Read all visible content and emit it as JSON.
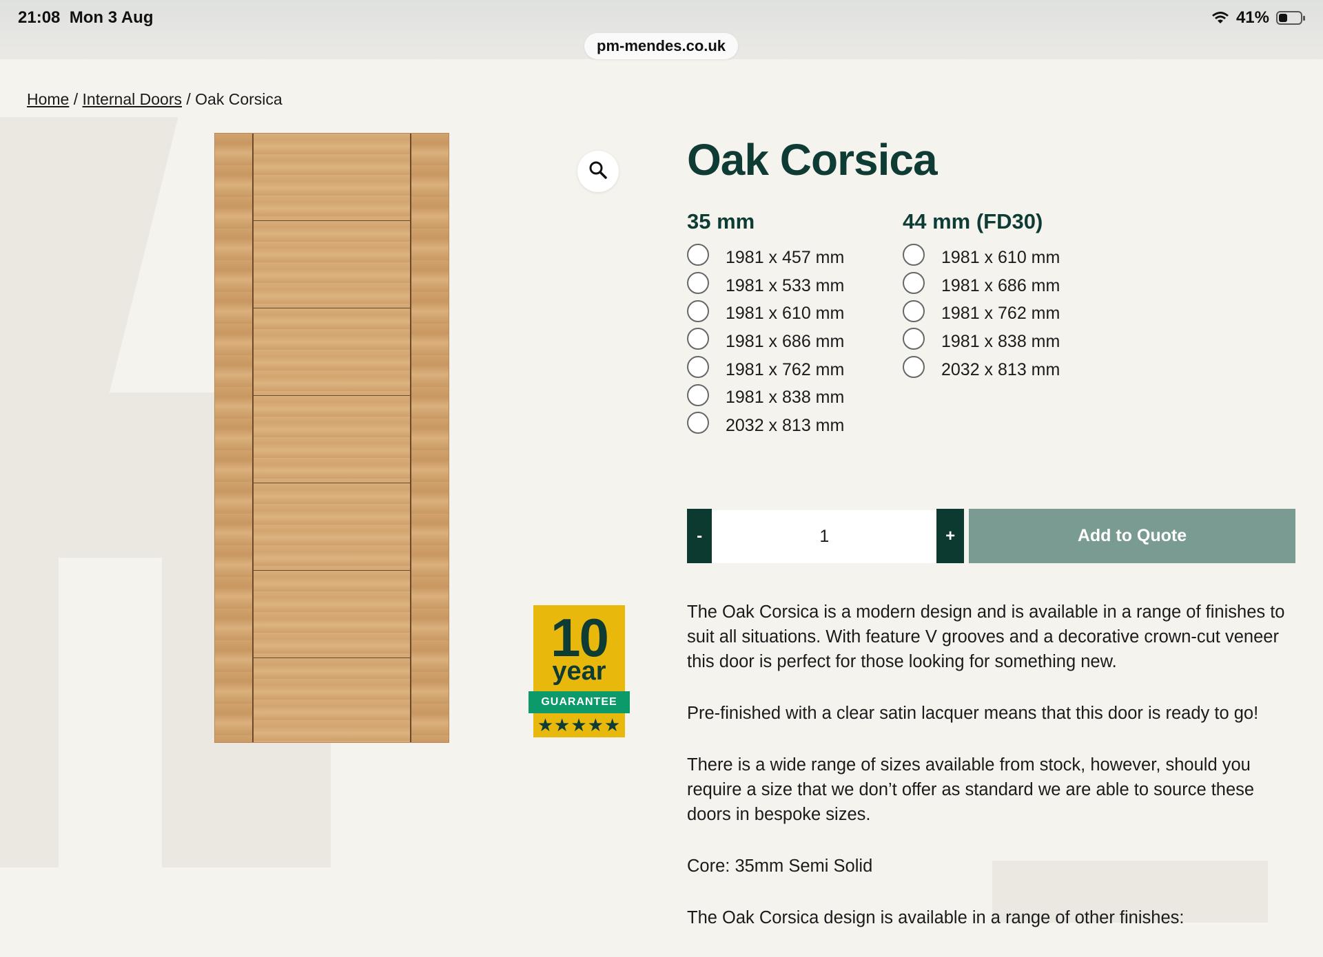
{
  "status_bar": {
    "time": "21:08",
    "date": "Mon 3 Aug",
    "battery": "41%",
    "battery_level": 0.41
  },
  "browser": {
    "url": "pm-mendes.co.uk"
  },
  "breadcrumb": {
    "home": "Home",
    "separator": "/",
    "category": "Internal Doors",
    "current": "Oak Corsica"
  },
  "product": {
    "title": "Oak Corsica",
    "image_icon": "door-image",
    "zoom_icon": "search-icon"
  },
  "guarantee_badge": {
    "number": "10",
    "unit": "year",
    "label": "GUARANTEE",
    "stars": "★★★★★"
  },
  "sizes": {
    "col1": {
      "heading": "35 mm",
      "options": [
        "1981 x 457 mm",
        "1981 x 533 mm",
        "1981 x 610 mm",
        "1981 x 686 mm",
        "1981 x 762 mm",
        "1981 x 838 mm",
        "2032 x 813 mm"
      ]
    },
    "col2": {
      "heading": "44 mm (FD30)",
      "options": [
        "1981 x 610 mm",
        "1981 x 686 mm",
        "1981 x 762 mm",
        "1981 x 838 mm",
        "2032 x 813 mm"
      ]
    }
  },
  "quantity": {
    "minus": "-",
    "value": "1",
    "plus": "+"
  },
  "add_to_quote": "Add to Quote",
  "description": {
    "p1": "The Oak Corsica is a modern design and is available in a range of finishes to suit all situations. With feature V grooves and a decorative crown-cut veneer this door is perfect for those looking for something new.",
    "p2": "Pre-finished with a clear satin lacquer means that this door is ready to go!",
    "p3": "There is a wide range of sizes available from stock, however, should you require a size that we don’t offer as standard we are able to source these doors in bespoke sizes.",
    "p4": "Core: 35mm Semi Solid",
    "p5": "The Oak Corsica design is available in a range of other finishes:"
  },
  "colors": {
    "brand_dark_green": "#0e3b33",
    "button_dark": "#0c3a31",
    "add_quote_bg": "#7a9b91",
    "badge_yellow": "#e8b80c",
    "badge_green": "#0c9a6b",
    "page_bg": "#f5f3ee"
  }
}
